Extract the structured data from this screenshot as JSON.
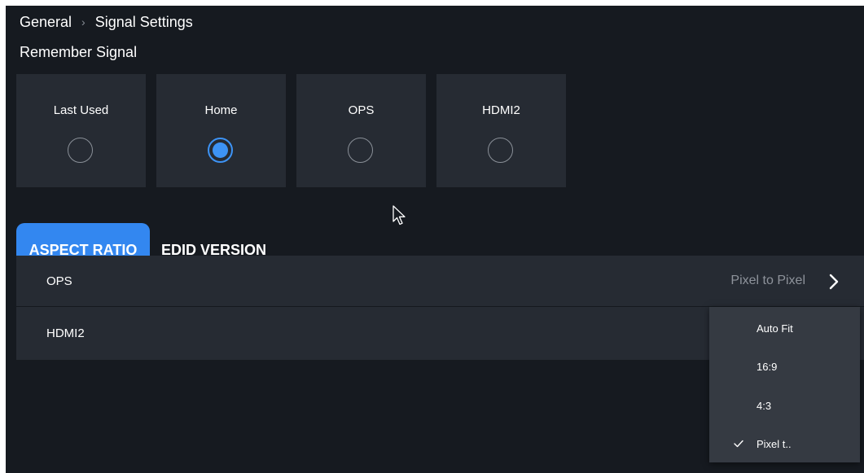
{
  "breadcrumb": {
    "parent": "General",
    "current": "Signal Settings"
  },
  "remember_signal": {
    "title": "Remember Signal",
    "options": [
      {
        "label": "Last Used",
        "selected": false
      },
      {
        "label": "Home",
        "selected": true
      },
      {
        "label": "OPS",
        "selected": false
      },
      {
        "label": "HDMI2",
        "selected": false
      }
    ]
  },
  "tabs": [
    {
      "label": "ASPECT RATIO",
      "active": true
    },
    {
      "label": "EDID VERSION",
      "active": false
    }
  ],
  "rows": [
    {
      "label": "OPS",
      "value": "Pixel to Pixel"
    },
    {
      "label": "HDMI2",
      "value": ""
    }
  ],
  "dropdown": {
    "items": [
      {
        "label": "Auto Fit",
        "checked": false
      },
      {
        "label": "16:9",
        "checked": false
      },
      {
        "label": "4:3",
        "checked": false
      },
      {
        "label": "Pixel t..",
        "checked": true
      }
    ]
  },
  "colors": {
    "background": "#161a20",
    "card": "#262b33",
    "accent": "#3387f0",
    "muted_text": "#8e939b",
    "dropdown": "#353a42"
  },
  "icons": {
    "breadcrumb_separator": "chevron-right-icon",
    "row_chevron": "chevron-right-icon",
    "check": "check-icon",
    "cursor": "mouse-pointer-icon"
  }
}
